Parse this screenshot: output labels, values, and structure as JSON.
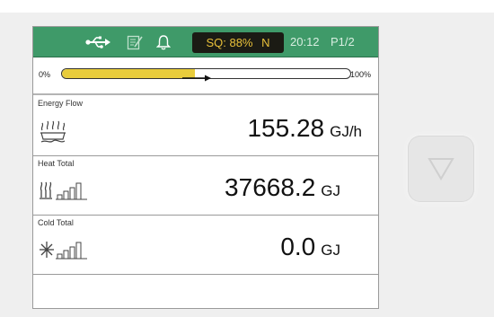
{
  "status_bar": {
    "icons": [
      "usb-icon",
      "edit-document-icon",
      "bell-icon"
    ],
    "signal_quality": "SQ: 88%",
    "signal_status": "N",
    "time": "20:12",
    "page": "P1/2",
    "colors": {
      "bar": "#3f9a69",
      "badge_bg": "#1b1b14",
      "badge_text": "#e9c13a"
    }
  },
  "progress": {
    "min_label": "0%",
    "max_label": "100%",
    "value_percent": 46,
    "fill_color": "#e8cc3c"
  },
  "rows": {
    "energy_flow": {
      "label": "Energy Flow",
      "value": "155.28",
      "unit": "GJ/h",
      "icon": "flow-icon"
    },
    "heat_total": {
      "label": "Heat Total",
      "value": "37668.2",
      "unit": "GJ",
      "icon": "heat-level-icon"
    },
    "cold_total": {
      "label": "Cold Total",
      "value": "0.0",
      "unit": "GJ",
      "icon": "cold-level-icon"
    }
  },
  "side_button": {
    "icon": "triangle-down-icon"
  }
}
